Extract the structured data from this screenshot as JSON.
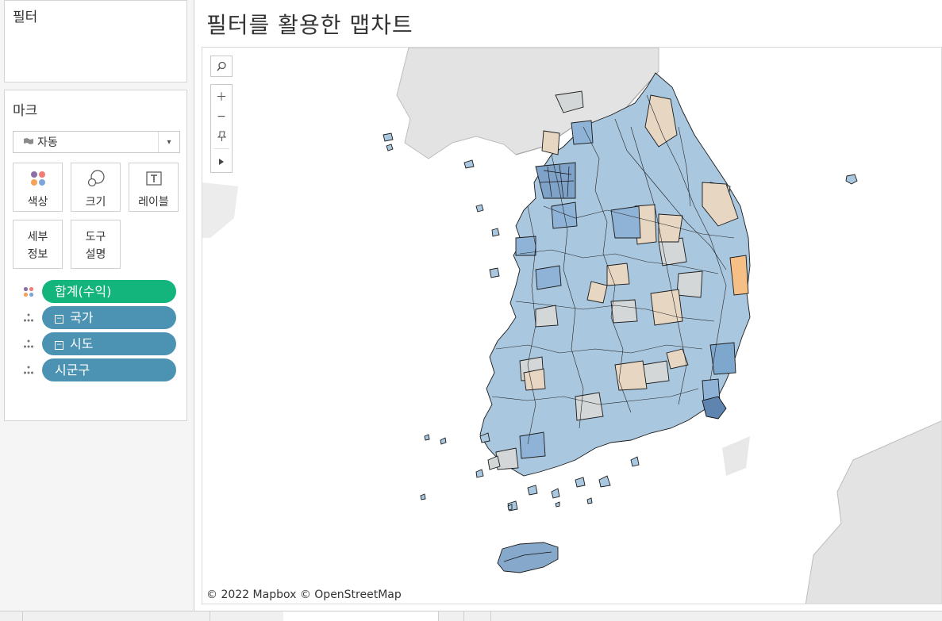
{
  "filters": {
    "title": "필터"
  },
  "marks": {
    "title": "마크",
    "type": "자동",
    "buttons": {
      "color": "색상",
      "size": "크기",
      "label": "레이블",
      "detail_1": "세부",
      "detail_2": "정보",
      "tooltip_1": "도구",
      "tooltip_2": "설명"
    },
    "pills": [
      {
        "label": "합계(수익)"
      },
      {
        "label": "국가"
      },
      {
        "label": "시도"
      },
      {
        "label": "시군구"
      }
    ]
  },
  "sheet": {
    "title": "필터를 활용한 맵차트"
  },
  "map": {
    "attribution": "© 2022 Mapbox © OpenStreetMap",
    "colors": {
      "positive": "#7fa7cc",
      "neutral": "#d6d6d3",
      "negative": "#f2b67a",
      "land": "#e4e4e4",
      "outline": "#111111"
    }
  }
}
